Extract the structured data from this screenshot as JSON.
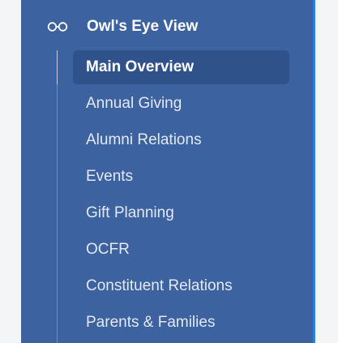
{
  "sidebar": {
    "section": {
      "title": "Owl's Eye View",
      "icon": "glasses-icon"
    },
    "items": [
      {
        "label": "Main Overview",
        "active": true
      },
      {
        "label": "Annual Giving",
        "active": false
      },
      {
        "label": "Alumni Relations",
        "active": false
      },
      {
        "label": "Events",
        "active": false
      },
      {
        "label": "Gift Planning",
        "active": false
      },
      {
        "label": "OCFR",
        "active": false
      },
      {
        "label": "Constituent Relations",
        "active": false
      },
      {
        "label": "Parents & Families",
        "active": false
      }
    ]
  },
  "colors": {
    "sidebar_bg": "#3d62a0",
    "active_item_bg": "#30528a",
    "text": "#e3e9f4",
    "accent_edge": "#2f7fe0",
    "page_bg": "#f4f5f7"
  }
}
